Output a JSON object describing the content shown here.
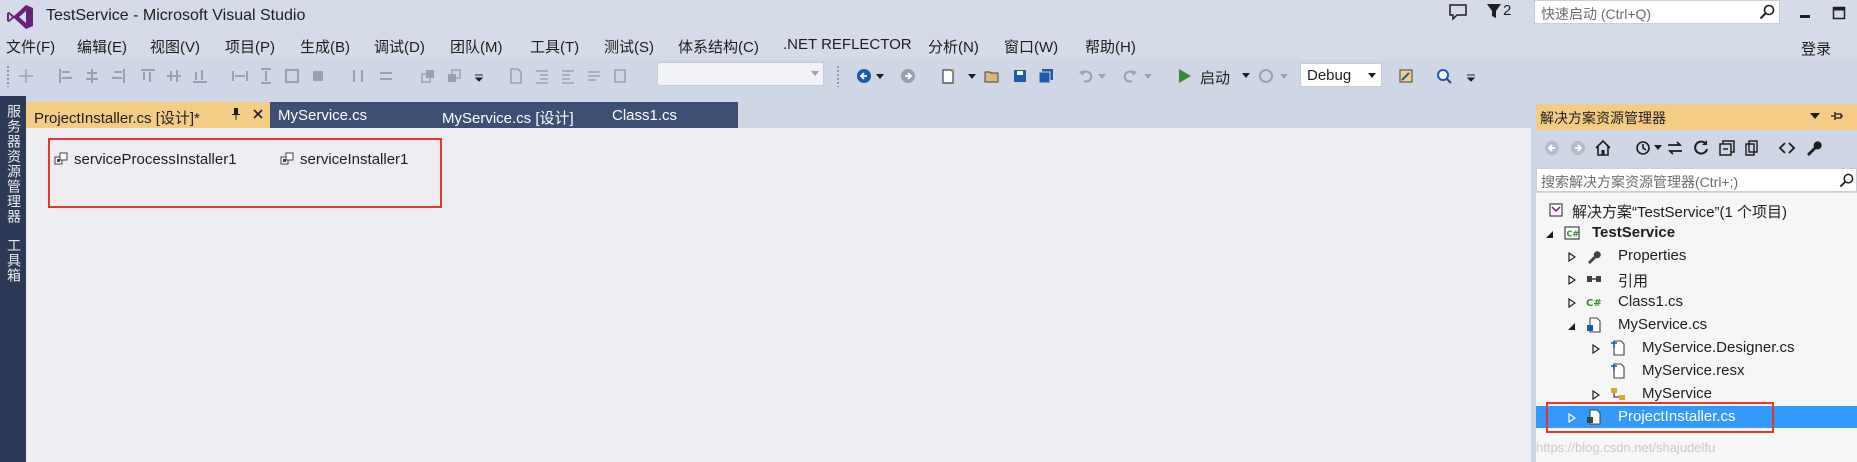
{
  "titlebar": {
    "title": "TestService - Microsoft Visual Studio",
    "notification_count": "2",
    "quick_launch_placeholder": "快速启动 (Ctrl+Q)"
  },
  "menubar": {
    "items": [
      "文件(F)",
      "编辑(E)",
      "视图(V)",
      "项目(P)",
      "生成(B)",
      "调试(D)",
      "团队(M)",
      "工具(T)",
      "测试(S)",
      "体系结构(C)",
      ".NET REFLECTOR",
      "分析(N)",
      "窗口(W)",
      "帮助(H)"
    ],
    "login": "登录"
  },
  "toolbar": {
    "start_label": "启动",
    "config_value": "Debug"
  },
  "side_strip": {
    "server_explorer": "服务器资源管理器",
    "toolbox": "工具箱"
  },
  "tabs": [
    {
      "label": "ProjectInstaller.cs [设计]*",
      "active": true
    },
    {
      "label": "MyService.cs",
      "active": false
    },
    {
      "label": "MyService.cs [设计]",
      "active": false
    },
    {
      "label": "Class1.cs",
      "active": false
    }
  ],
  "designer": {
    "components": [
      "serviceProcessInstaller1",
      "serviceInstaller1"
    ]
  },
  "solution_explorer": {
    "title": "解决方案资源管理器",
    "search_placeholder": "搜索解决方案资源管理器(Ctrl+;)",
    "tree": [
      {
        "label": "解决方案“TestService”(1 个项目)",
        "icon": "solution-icon"
      },
      {
        "label": "TestService",
        "icon": "csharp-project-icon"
      },
      {
        "label": "Properties",
        "icon": "wrench-icon"
      },
      {
        "label": "引用",
        "icon": "references-icon"
      },
      {
        "label": "Class1.cs",
        "icon": "csharp-file-icon"
      },
      {
        "label": "MyService.cs",
        "icon": "service-file-icon"
      },
      {
        "label": "MyService.Designer.cs",
        "icon": "designer-file-icon"
      },
      {
        "label": "MyService.resx",
        "icon": "resx-file-icon"
      },
      {
        "label": "MyService",
        "icon": "class-icon"
      },
      {
        "label": "ProjectInstaller.cs",
        "icon": "installer-file-icon",
        "selected": true
      }
    ]
  },
  "watermark": "https://blog.csdn.net/shajudelfu",
  "colors": {
    "chrome": "#d6dbe9",
    "active_tab": "#f5cc84",
    "inactive_tab": "#3d4f74",
    "side_strip": "#2d3a57",
    "selection": "#3399ff",
    "highlight_box": "#e8342e"
  }
}
